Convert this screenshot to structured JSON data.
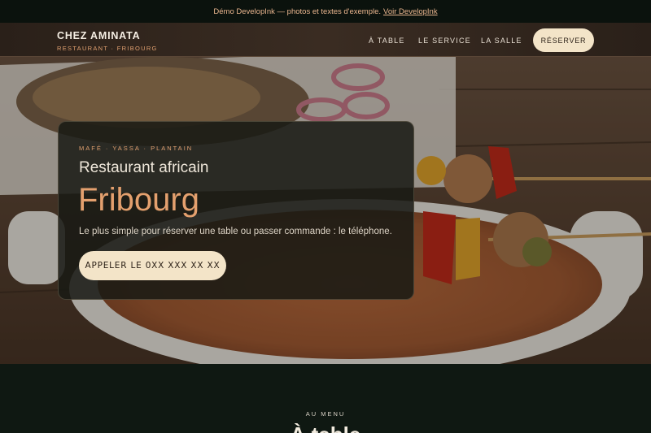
{
  "banner": {
    "text": "Démo DevelopInk — photos et textes d'exemple.",
    "link_label": "Voir DevelopInk"
  },
  "nav": {
    "brand_name": "CHEZ AMINATA",
    "brand_tagline": "RESTAURANT · FRIBOURG",
    "links": [
      "À TABLE",
      "LE SERVICE",
      "LA SALLE"
    ],
    "cta_label": "RÉSERVER"
  },
  "hero": {
    "eyebrow": "MAFÉ · YASSA · PLANTAIN",
    "subtitle": "Restaurant africain",
    "title": "Fribourg",
    "lead": "Le plus simple pour réserver une table ou passer commande : le téléphone.",
    "call_label": "APPELER LE 0XX XXX XX XX"
  },
  "menu_section": {
    "eyebrow": "AU MENU",
    "title": "À table"
  },
  "colors": {
    "accent": "#e4a06e",
    "cream": "#f3e4c8",
    "dark": "#0f1812"
  }
}
